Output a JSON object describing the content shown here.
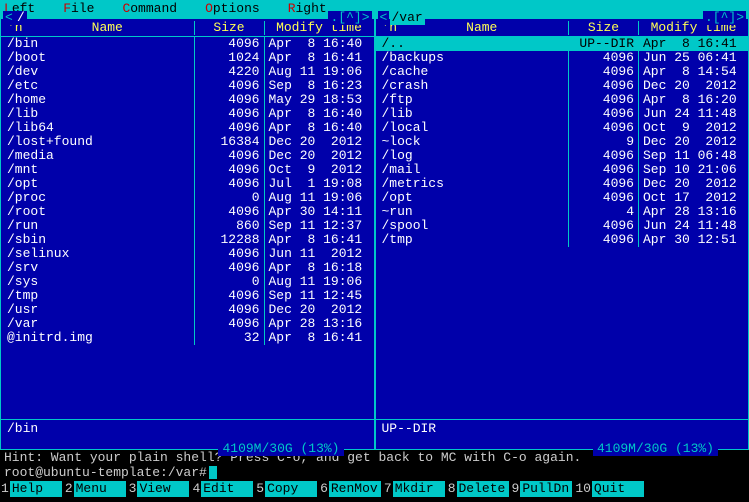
{
  "menu": {
    "left": {
      "full": "Left",
      "pre": "",
      "hot": "L",
      "post": "eft"
    },
    "file": {
      "full": "File",
      "pre": "",
      "hot": "F",
      "post": "ile"
    },
    "command": {
      "full": "Command",
      "pre": "",
      "hot": "C",
      "post": "ommand"
    },
    "options": {
      "full": "Options",
      "pre": "",
      "hot": "O",
      "post": "ptions"
    },
    "right": {
      "full": "Right",
      "pre": "",
      "hot": "R",
      "post": "ight"
    }
  },
  "corners": {
    "left": "<",
    "right": ".[^]>"
  },
  "headers": {
    "n": "'n",
    "name": "Name",
    "size": "Size",
    "mtime": "Modify time"
  },
  "left_panel": {
    "title": "/",
    "active": false,
    "rows": [
      {
        "name": "/bin",
        "size": "4096",
        "mtime": "Apr  8 16:40"
      },
      {
        "name": "/boot",
        "size": "1024",
        "mtime": "Apr  8 16:41"
      },
      {
        "name": "/dev",
        "size": "4220",
        "mtime": "Aug 11 19:06"
      },
      {
        "name": "/etc",
        "size": "4096",
        "mtime": "Sep  8 16:23"
      },
      {
        "name": "/home",
        "size": "4096",
        "mtime": "May 29 18:53"
      },
      {
        "name": "/lib",
        "size": "4096",
        "mtime": "Apr  8 16:40"
      },
      {
        "name": "/lib64",
        "size": "4096",
        "mtime": "Apr  8 16:40"
      },
      {
        "name": "/lost+found",
        "size": "16384",
        "mtime": "Dec 20  2012"
      },
      {
        "name": "/media",
        "size": "4096",
        "mtime": "Dec 20  2012"
      },
      {
        "name": "/mnt",
        "size": "4096",
        "mtime": "Oct  9  2012"
      },
      {
        "name": "/opt",
        "size": "4096",
        "mtime": "Jul  1 19:08"
      },
      {
        "name": "/proc",
        "size": "0",
        "mtime": "Aug 11 19:06"
      },
      {
        "name": "/root",
        "size": "4096",
        "mtime": "Apr 30 14:11"
      },
      {
        "name": "/run",
        "size": "860",
        "mtime": "Sep 11 12:37"
      },
      {
        "name": "/sbin",
        "size": "12288",
        "mtime": "Apr  8 16:41"
      },
      {
        "name": "/selinux",
        "size": "4096",
        "mtime": "Jun 11  2012"
      },
      {
        "name": "/srv",
        "size": "4096",
        "mtime": "Apr  8 16:18"
      },
      {
        "name": "/sys",
        "size": "0",
        "mtime": "Aug 11 19:06"
      },
      {
        "name": "/tmp",
        "size": "4096",
        "mtime": "Sep 11 12:45"
      },
      {
        "name": "/usr",
        "size": "4096",
        "mtime": "Dec 20  2012"
      },
      {
        "name": "/var",
        "size": "4096",
        "mtime": "Apr 28 13:16"
      },
      {
        "name": "@initrd.img",
        "size": "32",
        "mtime": "Apr  8 16:41"
      }
    ],
    "summary": "/bin",
    "disk": "4109M/30G (13%)"
  },
  "right_panel": {
    "title": "/var",
    "active": true,
    "rows": [
      {
        "name": "/..",
        "size": "UP--DIR",
        "mtime": "Apr  8 16:41",
        "sel": true
      },
      {
        "name": "/backups",
        "size": "4096",
        "mtime": "Jun 25 06:41"
      },
      {
        "name": "/cache",
        "size": "4096",
        "mtime": "Apr  8 14:54"
      },
      {
        "name": "/crash",
        "size": "4096",
        "mtime": "Dec 20  2012"
      },
      {
        "name": "/ftp",
        "size": "4096",
        "mtime": "Apr  8 16:20"
      },
      {
        "name": "/lib",
        "size": "4096",
        "mtime": "Jun 24 11:48"
      },
      {
        "name": "/local",
        "size": "4096",
        "mtime": "Oct  9  2012"
      },
      {
        "name": "~lock",
        "size": "9",
        "mtime": "Dec 20  2012"
      },
      {
        "name": "/log",
        "size": "4096",
        "mtime": "Sep 11 06:48"
      },
      {
        "name": "/mail",
        "size": "4096",
        "mtime": "Sep 10 21:06"
      },
      {
        "name": "/metrics",
        "size": "4096",
        "mtime": "Dec 20  2012"
      },
      {
        "name": "/opt",
        "size": "4096",
        "mtime": "Oct 17  2012"
      },
      {
        "name": "~run",
        "size": "4",
        "mtime": "Apr 28 13:16"
      },
      {
        "name": "/spool",
        "size": "4096",
        "mtime": "Jun 24 11:48"
      },
      {
        "name": "/tmp",
        "size": "4096",
        "mtime": "Apr 30 12:51"
      }
    ],
    "summary": "UP--DIR",
    "disk": "4109M/30G (13%)"
  },
  "hint": "Hint: Want your plain shell? Press C-o, and get back to MC with C-o again.",
  "prompt": "root@ubuntu-template:/var#",
  "fkeys": [
    {
      "n": "1",
      "label": "Help"
    },
    {
      "n": "2",
      "label": "Menu"
    },
    {
      "n": "3",
      "label": "View"
    },
    {
      "n": "4",
      "label": "Edit"
    },
    {
      "n": "5",
      "label": "Copy"
    },
    {
      "n": "6",
      "label": "RenMov"
    },
    {
      "n": "7",
      "label": "Mkdir"
    },
    {
      "n": "8",
      "label": "Delete"
    },
    {
      "n": "9",
      "label": "PullDn"
    },
    {
      "n": "10",
      "label": "Quit"
    }
  ]
}
